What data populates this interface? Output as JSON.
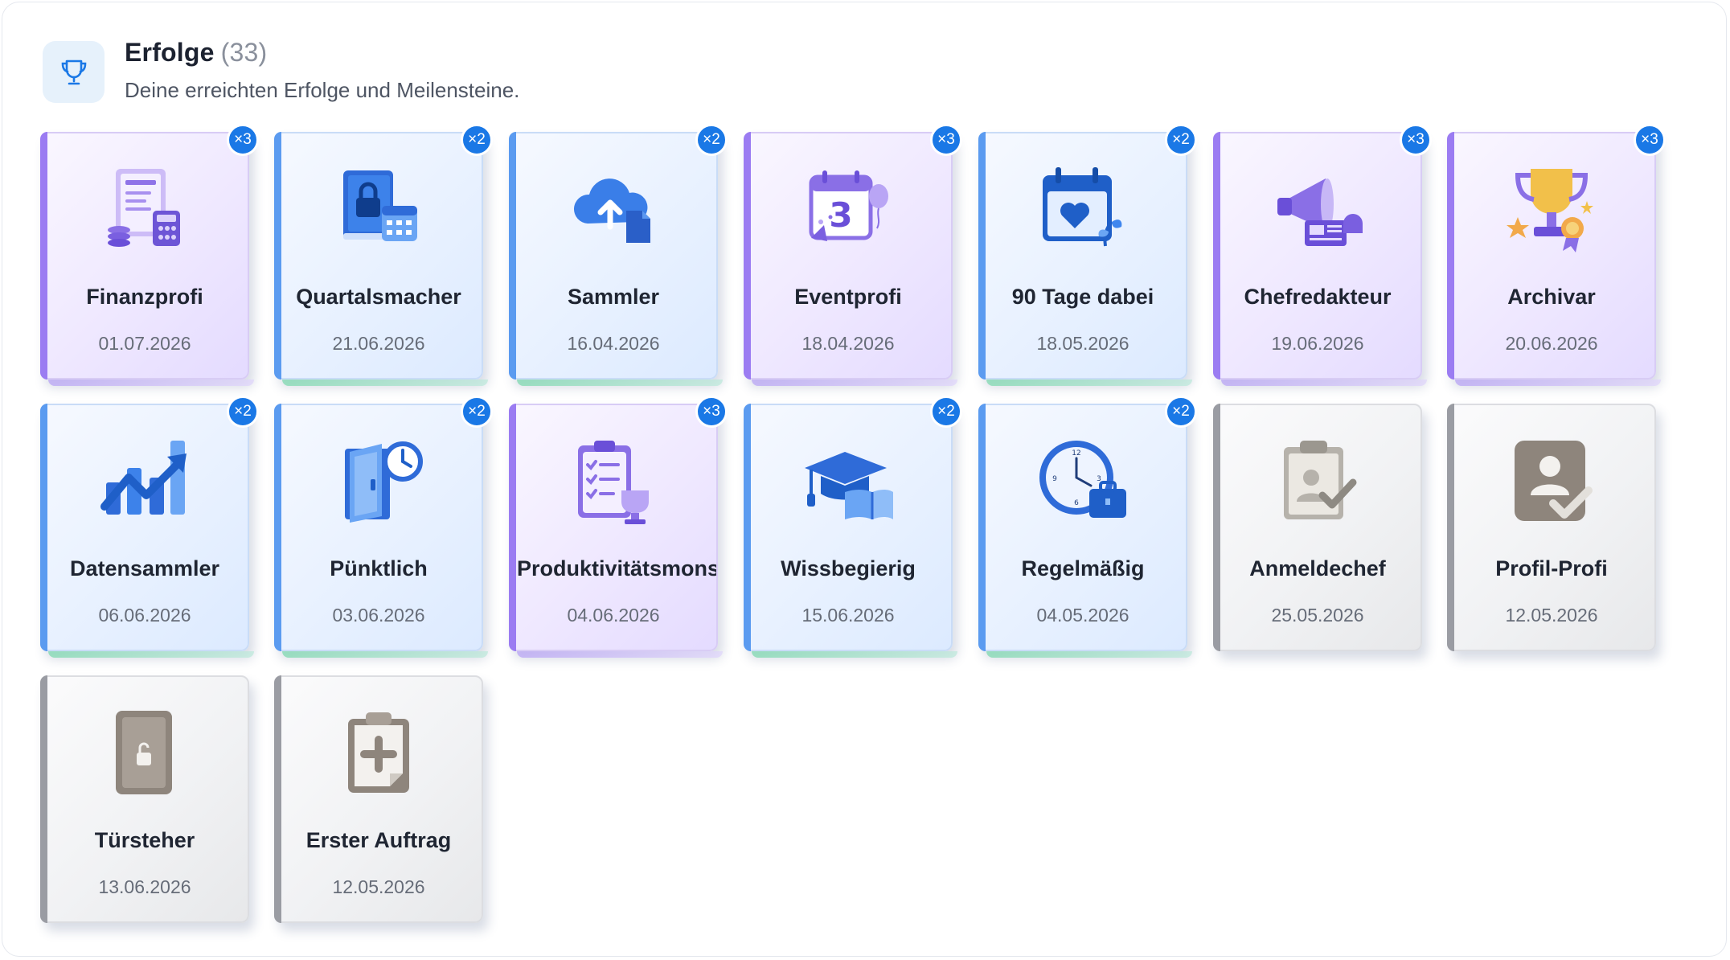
{
  "header": {
    "title": "Erfolge",
    "count": "(33)",
    "subtitle": "Deine erreichten Erfolge und Meilensteine.",
    "icon": "trophy-icon"
  },
  "achievements": [
    {
      "name": "Finanzprofi",
      "date": "01.07.2026",
      "badge": "×3",
      "style": "purple",
      "icon": "receipt-icon"
    },
    {
      "name": "Quartalsmacher",
      "date": "21.06.2026",
      "badge": "×2",
      "style": "blue",
      "icon": "locked-book-calendar-icon"
    },
    {
      "name": "Sammler",
      "date": "16.04.2026",
      "badge": "×2",
      "style": "blue",
      "icon": "cloud-upload-icon"
    },
    {
      "name": "Eventprofi",
      "date": "18.04.2026",
      "badge": "×3",
      "style": "purple",
      "icon": "event-calendar-icon"
    },
    {
      "name": "90 Tage dabei",
      "date": "18.05.2026",
      "badge": "×2",
      "style": "blue",
      "icon": "calendar-heart-icon"
    },
    {
      "name": "Chefredakteur",
      "date": "19.06.2026",
      "badge": "×3",
      "style": "purple",
      "icon": "megaphone-icon"
    },
    {
      "name": "Archivar",
      "date": "20.06.2026",
      "badge": "×3",
      "style": "purple",
      "icon": "trophy-award-icon"
    },
    {
      "name": "Datensammler",
      "date": "06.06.2026",
      "badge": "×2",
      "style": "blue",
      "icon": "trend-chart-icon"
    },
    {
      "name": "Pünktlich",
      "date": "03.06.2026",
      "badge": "×2",
      "style": "blue",
      "icon": "door-clock-icon"
    },
    {
      "name": "Produktivitätsmonster",
      "date": "04.06.2026",
      "badge": "×3",
      "style": "purple",
      "icon": "clipboard-trophy-icon"
    },
    {
      "name": "Wissbegierig",
      "date": "15.06.2026",
      "badge": "×2",
      "style": "blue",
      "icon": "graduation-cap-icon"
    },
    {
      "name": "Regelmäßig",
      "date": "04.05.2026",
      "badge": "×2",
      "style": "blue",
      "icon": "clock-briefcase-icon"
    },
    {
      "name": "Anmeldechef",
      "date": "25.05.2026",
      "badge": "",
      "style": "gray",
      "icon": "clipboard-user-check-icon"
    },
    {
      "name": "Profil-Profi",
      "date": "12.05.2026",
      "badge": "",
      "style": "gray",
      "icon": "profile-check-icon"
    },
    {
      "name": "Türsteher",
      "date": "13.06.2026",
      "badge": "",
      "style": "gray",
      "icon": "door-lock-icon"
    },
    {
      "name": "Erster Auftrag",
      "date": "12.05.2026",
      "badge": "",
      "style": "gray",
      "icon": "clipboard-plus-icon"
    }
  ]
}
